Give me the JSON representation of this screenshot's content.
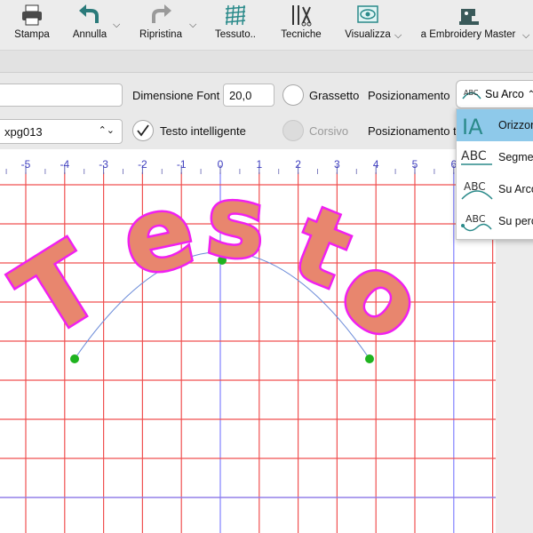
{
  "toolbar": {
    "stampa": "Stampa",
    "annulla": "Annulla",
    "ripristina": "Ripristina",
    "tessuto": "Tessuto..",
    "tecniche": "Tecniche",
    "visualizza": "Visualizza",
    "embroidery_master": "a Embroidery Master"
  },
  "options": {
    "text_value": "",
    "font_name": "xpg013",
    "dimensione_font_label": "Dimensione Font",
    "dimensione_font_value": "20,0",
    "grassetto_label": "Grassetto",
    "posizionamento_label": "Posizionamento",
    "testo_intelligente_label": "Testo intelligente",
    "testo_intelligente_checked": true,
    "corsivo_label": "Corsivo",
    "posizionamento2_label": "Posizionamento t"
  },
  "placement_dropdown": {
    "selected": "Su Arco",
    "items": [
      {
        "label": "Orizzon",
        "icon": "horizontal-text-icon",
        "selected": true
      },
      {
        "label": "Segme",
        "icon": "segment-text-icon",
        "selected": false
      },
      {
        "label": "Su Arco",
        "icon": "arc-text-icon",
        "selected": false
      },
      {
        "label": "Su perc",
        "icon": "path-text-icon",
        "selected": false
      }
    ]
  },
  "ruler": {
    "labels": [
      "-5",
      "-4",
      "-3",
      "-2",
      "-1",
      "0",
      "1",
      "2",
      "3",
      "4",
      "5",
      "6"
    ]
  },
  "embroidery": {
    "text": "Testo",
    "fill_color": "#e8866e",
    "outline_color": "#f020f0"
  },
  "colors": {
    "grid_line": "#f05050",
    "axis_line": "#8080ff",
    "handle": "#1fb31f",
    "selection": "#8ec9ea"
  }
}
